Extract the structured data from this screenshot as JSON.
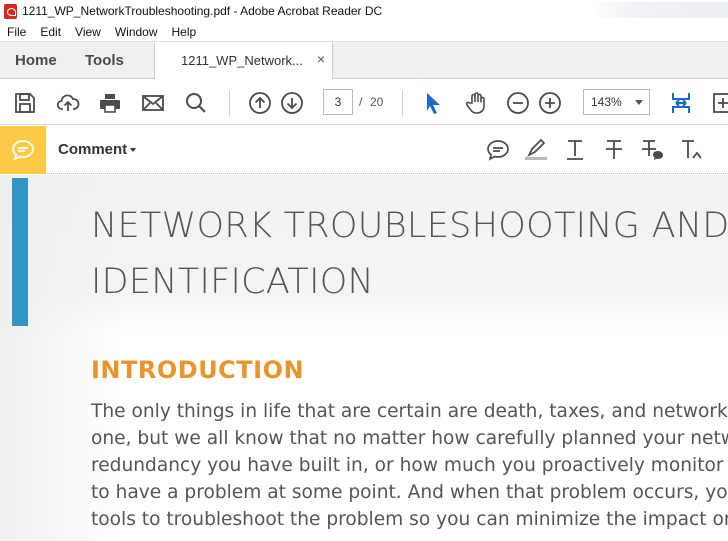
{
  "window": {
    "title": "1211_WP_NetworkTroubleshooting.pdf - Adobe Acrobat Reader DC"
  },
  "menu": [
    "File",
    "Edit",
    "View",
    "Window",
    "Help"
  ],
  "tabs": {
    "home": "Home",
    "tools": "Tools",
    "document": "1211_WP_Network...",
    "close": "×"
  },
  "toolbar": {
    "icons": [
      "save-icon",
      "upload-icon",
      "print-icon",
      "email-icon",
      "search-icon",
      "previous-page-icon",
      "next-page-icon",
      "select-cursor-icon",
      "hand-tool-icon",
      "zoom-out-icon",
      "zoom-in-icon",
      "fit-page-icon",
      "more-tools-icon"
    ],
    "current_page": "3",
    "page_separator": "/",
    "total_pages": "20",
    "zoom": "143%"
  },
  "comment_bar": {
    "label": "Comment",
    "icons": [
      "sticky-note-icon",
      "highlight-icon",
      "underline-text-icon",
      "strikethrough-icon",
      "replace-text-icon",
      "insert-text-icon"
    ]
  },
  "document": {
    "title_lines": [
      "NETWORK TROUBLESHOOTING AND",
      "IDENTIFICATION"
    ],
    "section_heading": "INTRODUCTION",
    "body_lines": [
      "The only things in life that are certain are death, taxes, and network issues. Okay,",
      "one, but we all know that no matter how carefully planned your network is, how much",
      "redundancy you have built in, or how much you proactively monitor your network, you're going",
      "to have a problem at some point. And when that problem occurs, you need the right",
      "tools to troubleshoot the problem so you can minimize the impact on your business."
    ]
  },
  "colors": {
    "comment_accent": "#fdca45",
    "heading_orange": "#e8952e",
    "side_bar_blue": "#3096c4",
    "tool_blue": "#1a6bc7"
  }
}
